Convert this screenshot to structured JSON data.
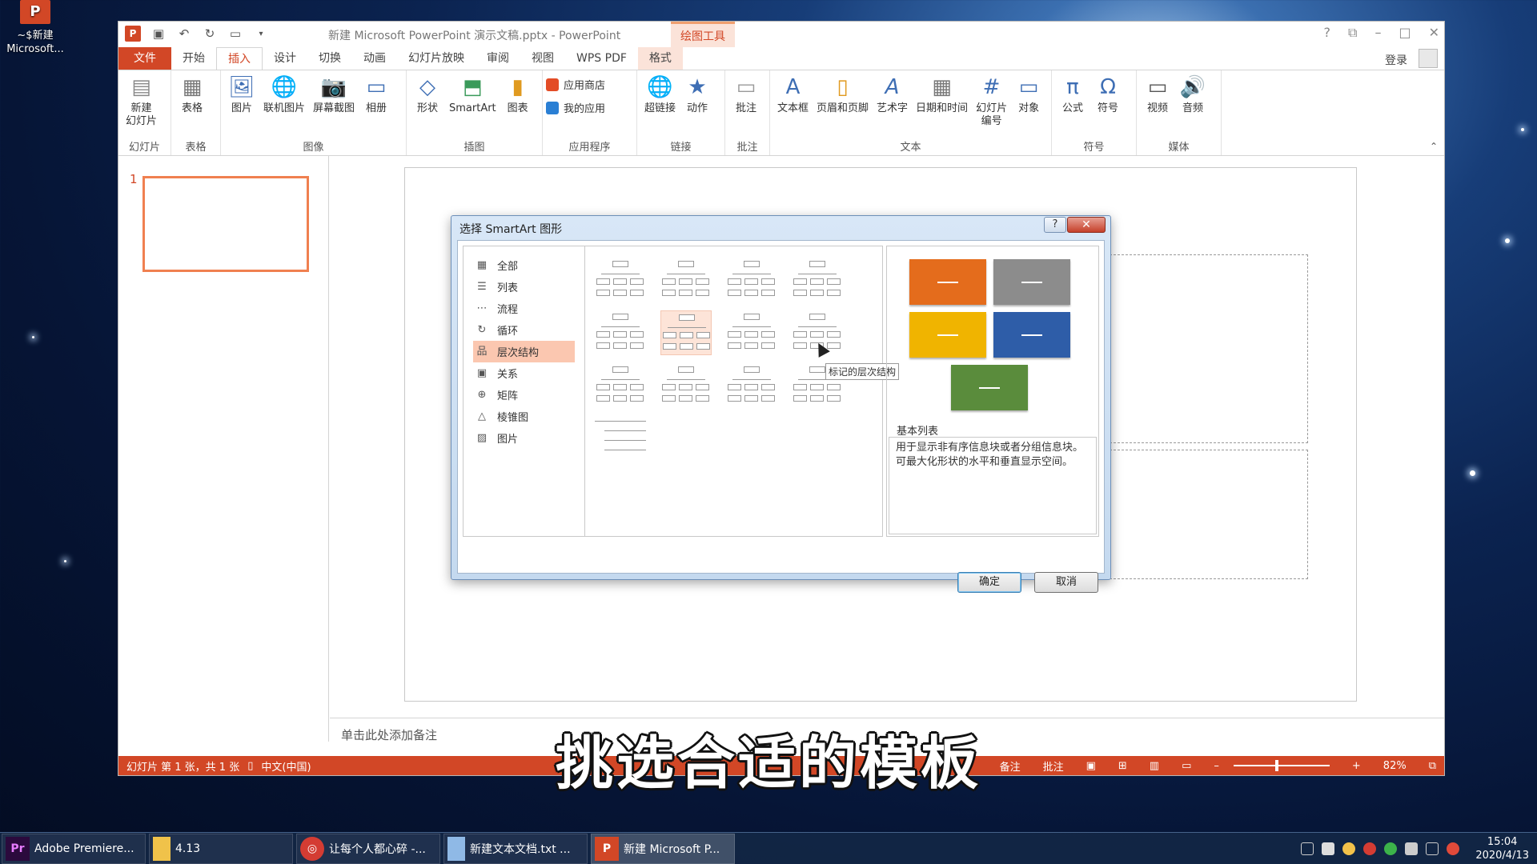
{
  "desktop": {
    "icon_label": "~$新建 Microsoft..."
  },
  "window": {
    "title": "新建 Microsoft PowerPoint 演示文稿.pptx - PowerPoint",
    "context_tab_group": "绘图工具",
    "login": "登录",
    "help": "?"
  },
  "tabs": [
    "文件",
    "开始",
    "插入",
    "设计",
    "切换",
    "动画",
    "幻灯片放映",
    "审阅",
    "视图",
    "WPS PDF",
    "格式"
  ],
  "ribbon": {
    "groups": {
      "slides": "幻灯片",
      "tables": "表格",
      "images": "图像",
      "illustrations": "插图",
      "apps": "应用程序",
      "links": "链接",
      "comments": "批注",
      "text": "文本",
      "symbols": "符号",
      "media": "媒体"
    },
    "buttons": {
      "new_slide": "新建\n幻灯片",
      "table": "表格",
      "picture": "图片",
      "online_picture": "联机图片",
      "screenshot": "屏幕截图",
      "album": "相册",
      "shapes": "形状",
      "smartart": "SmartArt",
      "chart": "图表",
      "store": "应用商店",
      "my_apps": "我的应用",
      "hyperlink": "超链接",
      "action": "动作",
      "comment": "批注",
      "textbox": "文本框",
      "header_footer": "页眉和页脚",
      "wordart": "艺术字",
      "datetime": "日期和时间",
      "slide_number": "幻灯片\n编号",
      "object": "对象",
      "equation": "公式",
      "symbol": "符号",
      "video": "视频",
      "audio": "音频"
    }
  },
  "slide_panel": {
    "number": "1"
  },
  "notes_placeholder": "单击此处添加备注",
  "statusbar": {
    "slide_info": "幻灯片 第 1 张，共 1 张",
    "language": "中文(中国)",
    "notes": "备注",
    "comments": "批注",
    "zoom": "82%"
  },
  "dialog": {
    "title": "选择 SmartArt 图形",
    "categories": [
      "全部",
      "列表",
      "流程",
      "循环",
      "层次结构",
      "关系",
      "矩阵",
      "棱锥图",
      "图片"
    ],
    "selected_category": "层次结构",
    "tooltip": "标记的层次结构",
    "preview_name": "基本列表",
    "preview_desc": "用于显示非有序信息块或者分组信息块。可最大化形状的水平和垂直显示空间。",
    "ok": "确定",
    "cancel": "取消",
    "preview_colors": [
      "#e46c1c",
      "#8c8c8c",
      "#f0b400",
      "#2e5da8",
      "#5a8c3c"
    ]
  },
  "caption": "挑选合适的模板",
  "taskbar": {
    "tasks": [
      "Adobe Premiere...",
      "4.13",
      "让每个人都心碎 -...",
      "新建文本文档.txt ...",
      "新建 Microsoft P..."
    ],
    "time": "15:04",
    "date": "2020/4/13"
  }
}
